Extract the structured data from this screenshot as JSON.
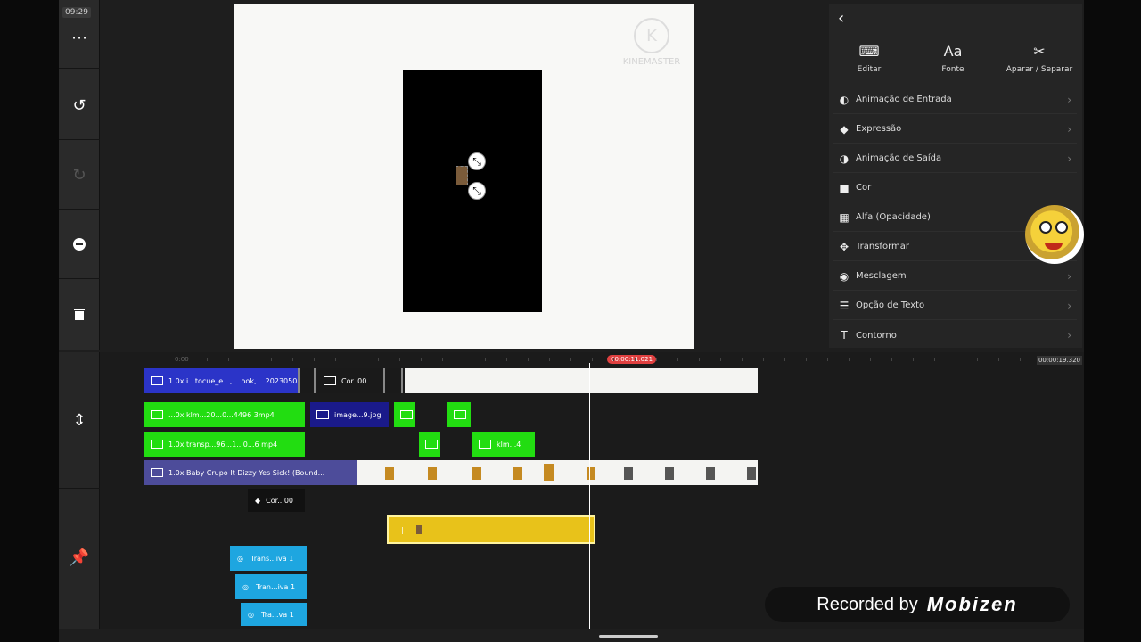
{
  "status": {
    "clock": "09:29"
  },
  "left_rail": {
    "more_icon": "more-icon",
    "undo_icon": "undo-icon",
    "redo_icon": "redo-icon",
    "keyframe_icon": "key-icon",
    "delete_icon": "trash-icon"
  },
  "preview": {
    "watermark_text": "KINEMASTER"
  },
  "panel": {
    "back_icon": "back-icon",
    "tabs": [
      {
        "label": "Editar",
        "icon": "keyboard-icon"
      },
      {
        "label": "Fonte",
        "icon": "font-icon"
      },
      {
        "label": "Aparar / Separar",
        "icon": "scissors-icon"
      }
    ],
    "items": [
      {
        "label": "Animação de Entrada",
        "icon": "toggle-icon"
      },
      {
        "label": "Expressão",
        "icon": "expression-icon"
      },
      {
        "label": "Animação de Saída",
        "icon": "toggle-icon"
      },
      {
        "label": "Cor",
        "icon": "color-swatch-icon"
      },
      {
        "label": "Alfa (Opacidade)",
        "icon": "alpha-icon"
      },
      {
        "label": "Transformar",
        "icon": "move-icon"
      },
      {
        "label": "Mesclagem",
        "icon": "blend-icon"
      },
      {
        "label": "Opção de Texto",
        "icon": "text-option-icon"
      },
      {
        "label": "Contorno",
        "icon": "outline-icon"
      }
    ]
  },
  "timeline": {
    "time_start": "0:00",
    "playhead_time": "00:00:11.021",
    "time_end": "00:00:19.320",
    "clips": {
      "row1_a": "1.0x i...tocue_e..., ...ook, ...20230501",
      "row1_b": "Cor..00",
      "row1_c": "...",
      "row2_a": "...0x klm...20...0...4496 3mp4",
      "row2_b": "image...9.jpg",
      "row3_a": "1.0x transp...96...1...0...6 mp4",
      "row3_b": "klm...4",
      "row4_a": "1.0x Baby Crupo It Dizzy Yes Sick! (Bound...",
      "color_clip": "Cor...00",
      "trans1": "Trans...iva 1",
      "trans2": "Tran...iva 1",
      "trans3": "Tra...va 1"
    }
  },
  "overlay": {
    "recorded_by": "Recorded by",
    "brand": "Mobizen"
  }
}
